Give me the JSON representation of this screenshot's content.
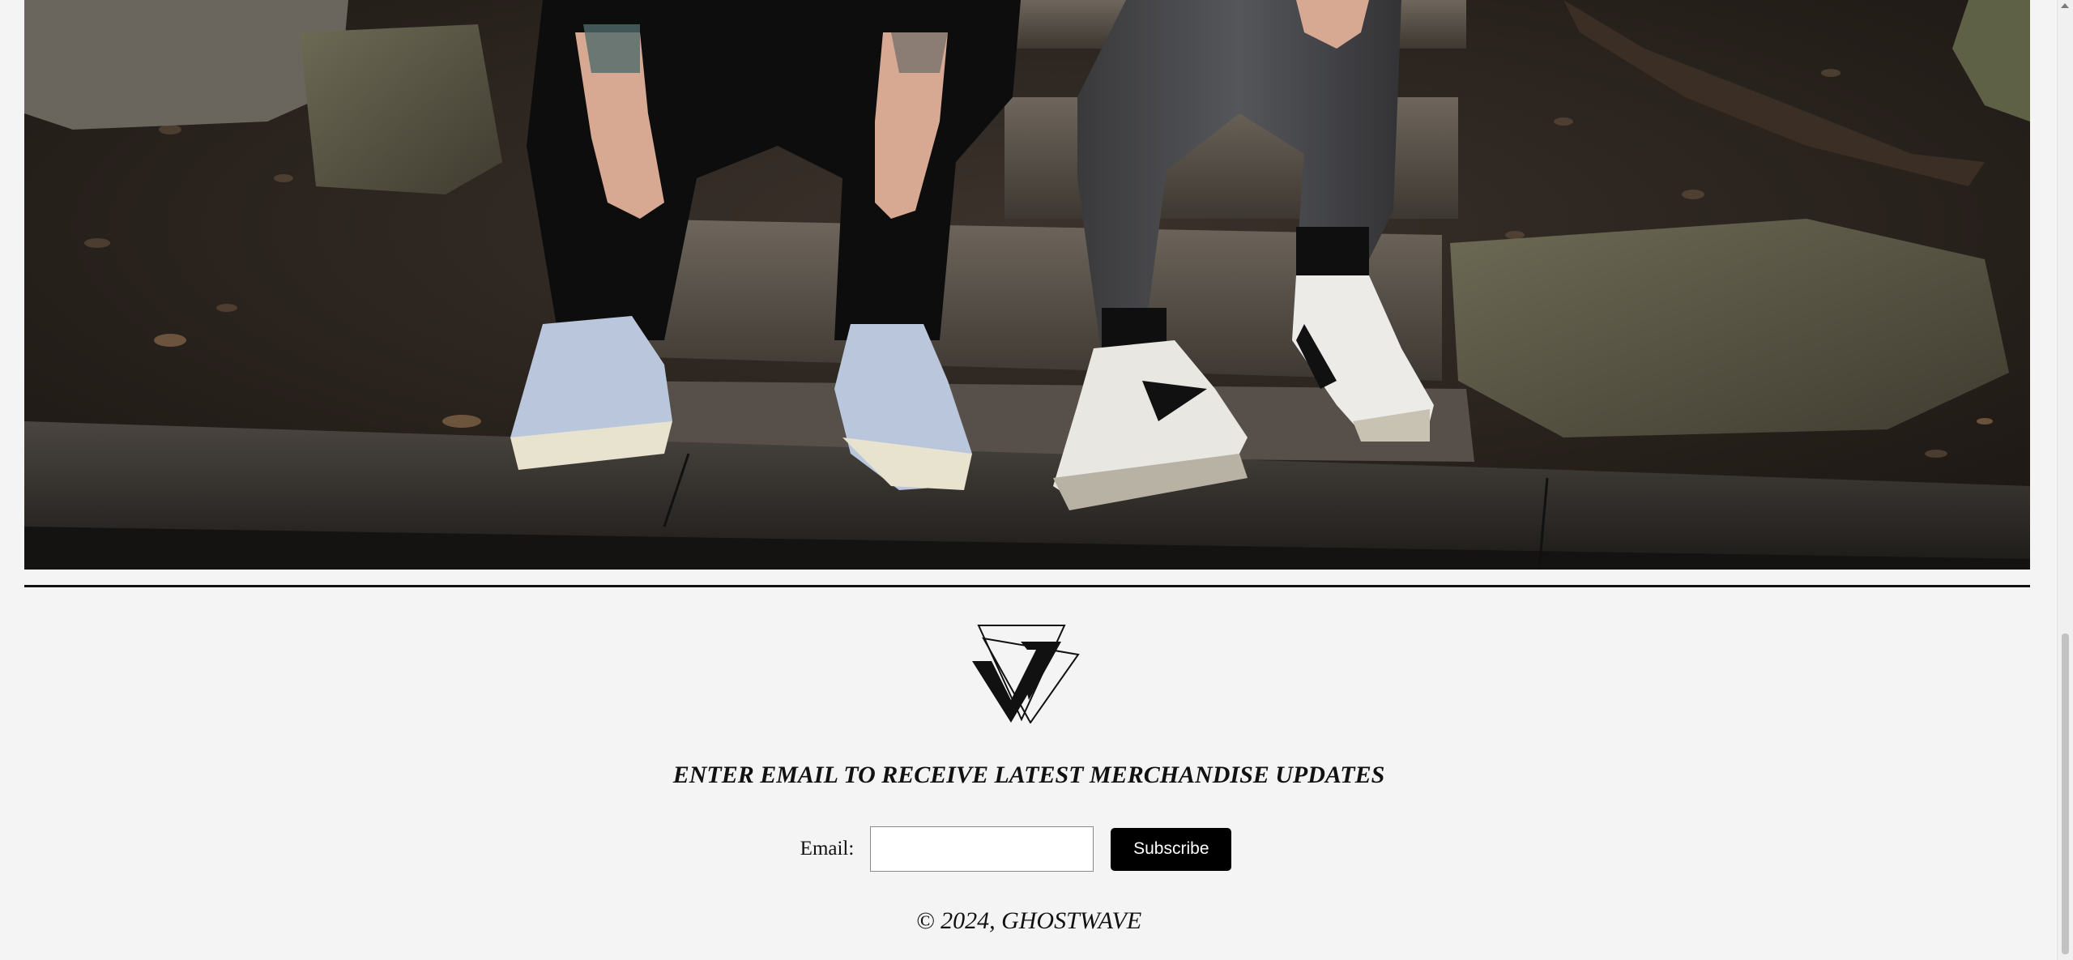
{
  "hero": {
    "alt": "Two people in black sitting on outdoor stone steps wearing sneakers"
  },
  "logo": {
    "icon": "triangle-logo-icon"
  },
  "newsletter": {
    "heading": "ENTER EMAIL TO RECEIVE LATEST MERCHANDISE UPDATES",
    "email_label": "Email:",
    "email_value": "",
    "email_placeholder": "",
    "subscribe_label": "Subscribe"
  },
  "footer": {
    "copyright": "© 2024, GHOSTWAVE"
  },
  "colors": {
    "background": "#f4f4f4",
    "button": "#000000",
    "button_text": "#ffffff",
    "divider": "#111111"
  }
}
